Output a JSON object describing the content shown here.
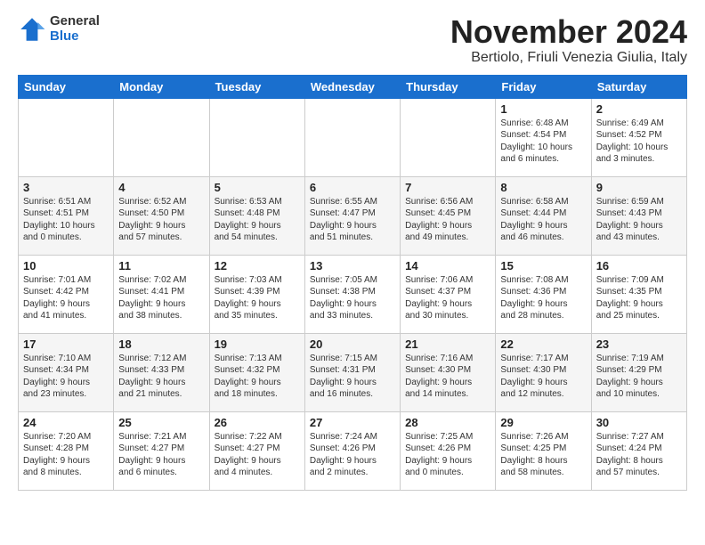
{
  "header": {
    "logo_general": "General",
    "logo_blue": "Blue",
    "month_title": "November 2024",
    "location": "Bertiolo, Friuli Venezia Giulia, Italy"
  },
  "days_of_week": [
    "Sunday",
    "Monday",
    "Tuesday",
    "Wednesday",
    "Thursday",
    "Friday",
    "Saturday"
  ],
  "weeks": [
    [
      {
        "day": "",
        "info": ""
      },
      {
        "day": "",
        "info": ""
      },
      {
        "day": "",
        "info": ""
      },
      {
        "day": "",
        "info": ""
      },
      {
        "day": "",
        "info": ""
      },
      {
        "day": "1",
        "info": "Sunrise: 6:48 AM\nSunset: 4:54 PM\nDaylight: 10 hours\nand 6 minutes."
      },
      {
        "day": "2",
        "info": "Sunrise: 6:49 AM\nSunset: 4:52 PM\nDaylight: 10 hours\nand 3 minutes."
      }
    ],
    [
      {
        "day": "3",
        "info": "Sunrise: 6:51 AM\nSunset: 4:51 PM\nDaylight: 10 hours\nand 0 minutes."
      },
      {
        "day": "4",
        "info": "Sunrise: 6:52 AM\nSunset: 4:50 PM\nDaylight: 9 hours\nand 57 minutes."
      },
      {
        "day": "5",
        "info": "Sunrise: 6:53 AM\nSunset: 4:48 PM\nDaylight: 9 hours\nand 54 minutes."
      },
      {
        "day": "6",
        "info": "Sunrise: 6:55 AM\nSunset: 4:47 PM\nDaylight: 9 hours\nand 51 minutes."
      },
      {
        "day": "7",
        "info": "Sunrise: 6:56 AM\nSunset: 4:45 PM\nDaylight: 9 hours\nand 49 minutes."
      },
      {
        "day": "8",
        "info": "Sunrise: 6:58 AM\nSunset: 4:44 PM\nDaylight: 9 hours\nand 46 minutes."
      },
      {
        "day": "9",
        "info": "Sunrise: 6:59 AM\nSunset: 4:43 PM\nDaylight: 9 hours\nand 43 minutes."
      }
    ],
    [
      {
        "day": "10",
        "info": "Sunrise: 7:01 AM\nSunset: 4:42 PM\nDaylight: 9 hours\nand 41 minutes."
      },
      {
        "day": "11",
        "info": "Sunrise: 7:02 AM\nSunset: 4:41 PM\nDaylight: 9 hours\nand 38 minutes."
      },
      {
        "day": "12",
        "info": "Sunrise: 7:03 AM\nSunset: 4:39 PM\nDaylight: 9 hours\nand 35 minutes."
      },
      {
        "day": "13",
        "info": "Sunrise: 7:05 AM\nSunset: 4:38 PM\nDaylight: 9 hours\nand 33 minutes."
      },
      {
        "day": "14",
        "info": "Sunrise: 7:06 AM\nSunset: 4:37 PM\nDaylight: 9 hours\nand 30 minutes."
      },
      {
        "day": "15",
        "info": "Sunrise: 7:08 AM\nSunset: 4:36 PM\nDaylight: 9 hours\nand 28 minutes."
      },
      {
        "day": "16",
        "info": "Sunrise: 7:09 AM\nSunset: 4:35 PM\nDaylight: 9 hours\nand 25 minutes."
      }
    ],
    [
      {
        "day": "17",
        "info": "Sunrise: 7:10 AM\nSunset: 4:34 PM\nDaylight: 9 hours\nand 23 minutes."
      },
      {
        "day": "18",
        "info": "Sunrise: 7:12 AM\nSunset: 4:33 PM\nDaylight: 9 hours\nand 21 minutes."
      },
      {
        "day": "19",
        "info": "Sunrise: 7:13 AM\nSunset: 4:32 PM\nDaylight: 9 hours\nand 18 minutes."
      },
      {
        "day": "20",
        "info": "Sunrise: 7:15 AM\nSunset: 4:31 PM\nDaylight: 9 hours\nand 16 minutes."
      },
      {
        "day": "21",
        "info": "Sunrise: 7:16 AM\nSunset: 4:30 PM\nDaylight: 9 hours\nand 14 minutes."
      },
      {
        "day": "22",
        "info": "Sunrise: 7:17 AM\nSunset: 4:30 PM\nDaylight: 9 hours\nand 12 minutes."
      },
      {
        "day": "23",
        "info": "Sunrise: 7:19 AM\nSunset: 4:29 PM\nDaylight: 9 hours\nand 10 minutes."
      }
    ],
    [
      {
        "day": "24",
        "info": "Sunrise: 7:20 AM\nSunset: 4:28 PM\nDaylight: 9 hours\nand 8 minutes."
      },
      {
        "day": "25",
        "info": "Sunrise: 7:21 AM\nSunset: 4:27 PM\nDaylight: 9 hours\nand 6 minutes."
      },
      {
        "day": "26",
        "info": "Sunrise: 7:22 AM\nSunset: 4:27 PM\nDaylight: 9 hours\nand 4 minutes."
      },
      {
        "day": "27",
        "info": "Sunrise: 7:24 AM\nSunset: 4:26 PM\nDaylight: 9 hours\nand 2 minutes."
      },
      {
        "day": "28",
        "info": "Sunrise: 7:25 AM\nSunset: 4:26 PM\nDaylight: 9 hours\nand 0 minutes."
      },
      {
        "day": "29",
        "info": "Sunrise: 7:26 AM\nSunset: 4:25 PM\nDaylight: 8 hours\nand 58 minutes."
      },
      {
        "day": "30",
        "info": "Sunrise: 7:27 AM\nSunset: 4:24 PM\nDaylight: 8 hours\nand 57 minutes."
      }
    ]
  ]
}
